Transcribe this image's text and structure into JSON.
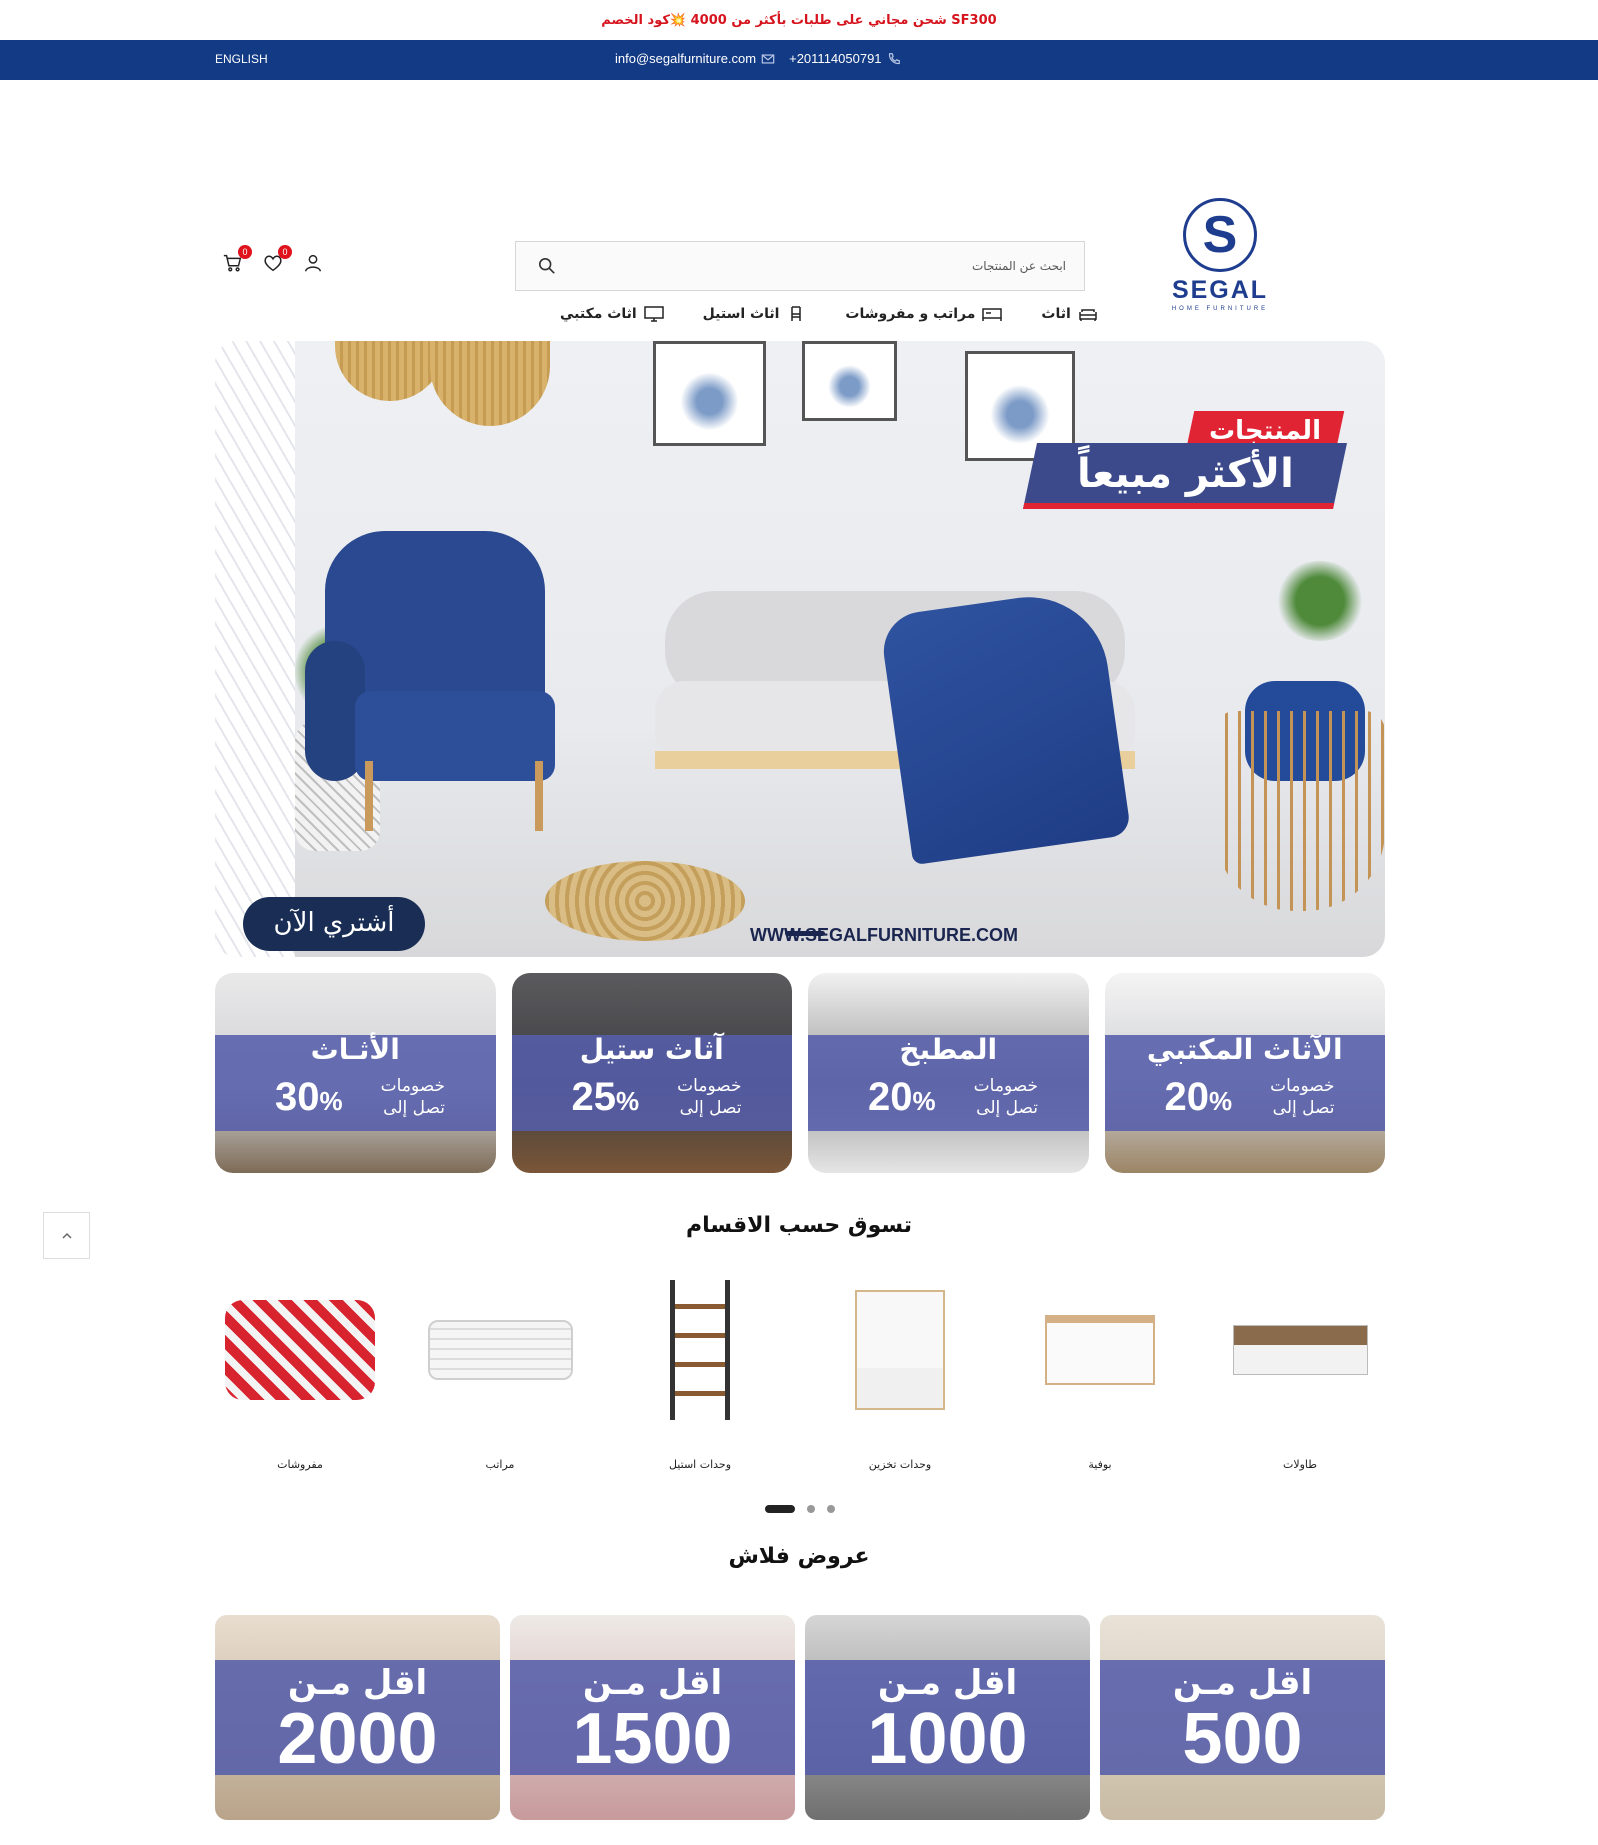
{
  "announcement": "شحن مجاني على طلبات بأكثر من 4000 💥كود الخصم SF300",
  "topbar": {
    "language": "ENGLISH",
    "email": "info@segalfurniture.com",
    "phone": "+201114050791"
  },
  "header": {
    "cart_count": "0",
    "wishlist_count": "0",
    "search_placeholder": "ابحث عن المنتجات",
    "logo": {
      "brand": "SEGAL",
      "tagline": "HOME FURNITURE",
      "mark": "S"
    }
  },
  "nav": [
    {
      "label": "اثاث مكتبي",
      "icon": "monitor-icon"
    },
    {
      "label": "اثاث استيل",
      "icon": "chair-icon"
    },
    {
      "label": "مراتب و مفروشات",
      "icon": "bed-icon"
    },
    {
      "label": "اثاث",
      "icon": "sofa-icon"
    }
  ],
  "hero": {
    "headline_top": "المنتجات",
    "headline_main": "الأكثر مبيعاً",
    "cta": "أشتري الآن",
    "url": "WWW.SEGALFURNITURE.COM"
  },
  "promos": [
    {
      "title": "الأثـاث",
      "percent": "30",
      "text": "خصومات تصل إلى"
    },
    {
      "title": "آثاث ستيل",
      "percent": "25",
      "text": "خصومات تصل إلى"
    },
    {
      "title": "المطبخ",
      "percent": "20",
      "text": "خصومات تصل إلى"
    },
    {
      "title": "الآثاث المكتبي",
      "percent": "20",
      "text": "خصومات تصل إلى"
    }
  ],
  "categories_title": "تسوق حسب الاقسام",
  "categories": [
    {
      "label": "مفروشات"
    },
    {
      "label": "مراتب"
    },
    {
      "label": "وحدات استيل"
    },
    {
      "label": "وحدات تخزين"
    },
    {
      "label": "بوفية"
    },
    {
      "label": "طاولات"
    }
  ],
  "carousel": {
    "pages": 3,
    "active": 1
  },
  "flash_title": "عروض فلاش",
  "flash": [
    {
      "prefix": "اقل مـن",
      "amount": "2000"
    },
    {
      "prefix": "اقل مـن",
      "amount": "1500"
    },
    {
      "prefix": "اقل مـن",
      "amount": "1000"
    },
    {
      "prefix": "اقل مـن",
      "amount": "500"
    }
  ],
  "colors": {
    "topbar": "#133a85",
    "brand": "#1f3d8f",
    "announce": "#d6141e",
    "badge": "#e0121c",
    "promo_band": "#555daa"
  }
}
